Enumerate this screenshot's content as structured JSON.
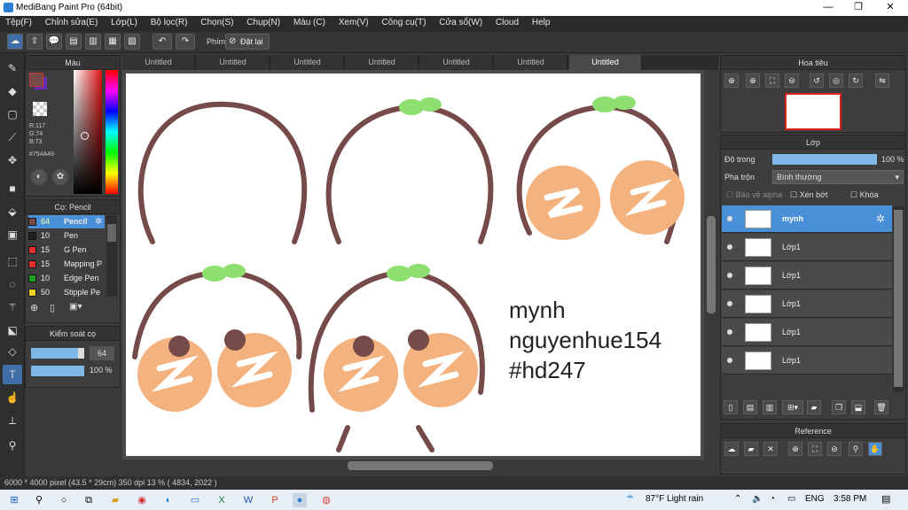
{
  "window": {
    "title": "MediBang Paint Pro (64bit)"
  },
  "menu": [
    "Tệp(F)",
    "Chỉnh sửa(E)",
    "Lớp(L)",
    "Bộ lọc(R)",
    "Chọn(S)",
    "Chụp(N)",
    "Màu (C)",
    "Xem(V)",
    "Công cụ(T)",
    "Cửa sổ(W)",
    "Cloud",
    "Help"
  ],
  "toolbar": {
    "phim_label": "Phím",
    "reset_label": "Đặt lại"
  },
  "color_panel": {
    "title": "Màu",
    "r": "R:117",
    "g": "G:74",
    "b": "B:73",
    "hex": "#754A49",
    "primary": "#754a49",
    "secondary": "#6a2fb8"
  },
  "brush_panel": {
    "title": "Cọ: Pencil",
    "items": [
      {
        "size": "64",
        "name": "Pencil",
        "color": "#754a49"
      },
      {
        "size": "10",
        "name": "Pen",
        "color": "#222222"
      },
      {
        "size": "15",
        "name": "G Pen",
        "color": "#e03030"
      },
      {
        "size": "15",
        "name": "Mapping P",
        "color": "#e03030"
      },
      {
        "size": "10",
        "name": "Edge Pen",
        "color": "#20a020"
      },
      {
        "size": "50",
        "name": "Stipple Pe",
        "color": "#e8d020"
      }
    ]
  },
  "control_panel": {
    "title": "Kiểm soát cọ",
    "size_value": "64",
    "opacity_value": "100 %",
    "size_level": 0.88,
    "opacity_level": 1.0
  },
  "tabs": [
    "Untitled",
    "Untitled",
    "Untitled",
    "Untitled",
    "Untitled",
    "Untitled",
    "Untitled"
  ],
  "canvas_text": {
    "line1": "mynh",
    "line2": "nguyenhue154",
    "line3": "#hd247"
  },
  "navigator": {
    "title": "Hoa tiêu"
  },
  "layer_panel": {
    "title": "Lớp",
    "opacity_label": "Độ trong",
    "opacity_value": "100 %",
    "opacity_level": 1.0,
    "blend_label": "Pha trộn",
    "blend_value": "Bình thường",
    "protect_alpha": "Bảo vệ alpha",
    "clip": "Xén bớt",
    "lock": "Khóa",
    "layers": [
      {
        "name": "mynh",
        "selected": true
      },
      {
        "name": "Lớp1"
      },
      {
        "name": "Lớp1"
      },
      {
        "name": "Lớp1"
      },
      {
        "name": "Lớp1"
      },
      {
        "name": "Lớp1"
      }
    ]
  },
  "reference_panel": {
    "title": "Reference"
  },
  "status": {
    "text": "6000 * 4000 pixel   (43.5 * 29cm)   350 dpi   13 %   ( 4834, 2022 )"
  },
  "taskbar": {
    "weather": "87°F  Light rain",
    "lang": "ENG",
    "time": "3:58 PM"
  }
}
